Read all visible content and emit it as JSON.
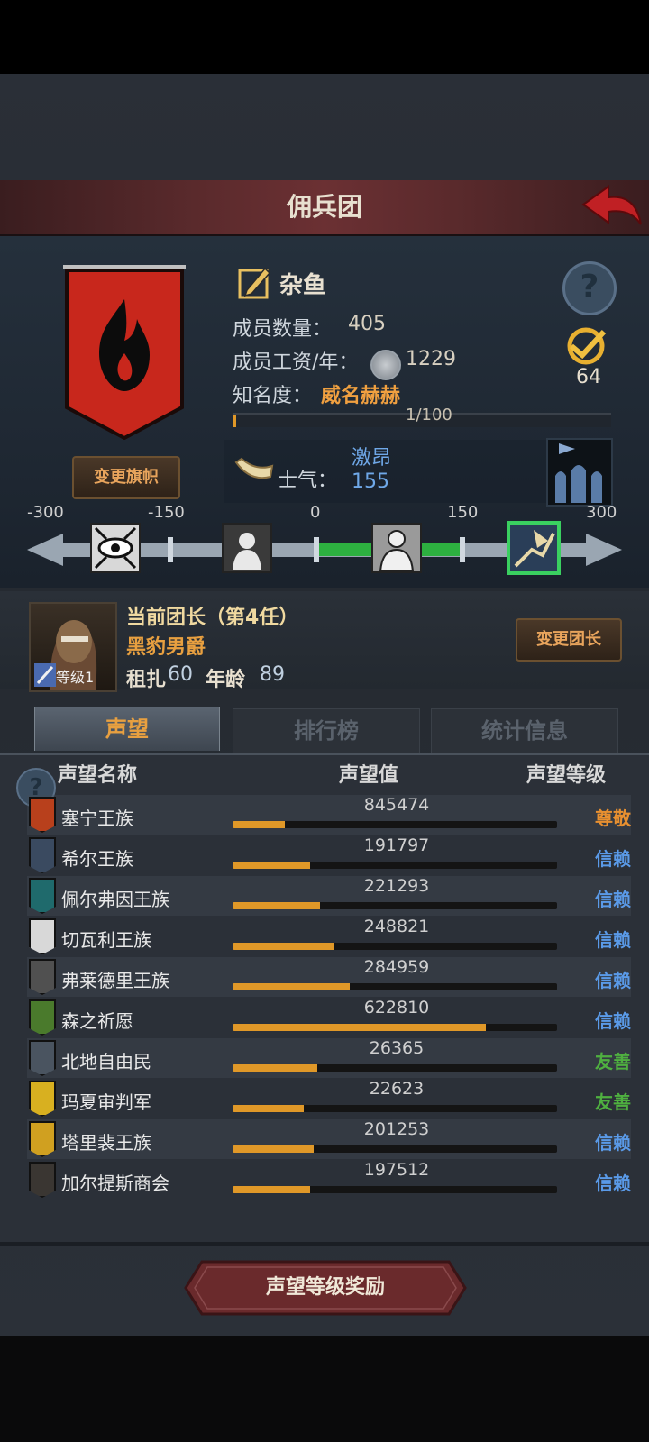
{
  "title": "佣兵团",
  "guild": {
    "name": "杂鱼",
    "members_label": "成员数量：",
    "members_value": "405",
    "salary_label": "成员工资/年：",
    "salary_value": "1229",
    "fame_label": "知名度：",
    "fame_value": "威名赫赫",
    "fame_progress_text": "1/100",
    "fame_progress_fraction": 0.01,
    "badge_count": "64",
    "change_banner_label": "变更旗帜"
  },
  "morale": {
    "label": "士气：",
    "state": "激昂",
    "value": "155",
    "ticks": [
      "-300",
      "-150",
      "0",
      "150",
      "300"
    ]
  },
  "leader": {
    "heading": "当前团长（第4任）",
    "name": "黑豹男爵",
    "race": "租扎",
    "race_num": "60",
    "age_label": "年龄",
    "age": "89",
    "level": "等级1",
    "change_label": "变更团长"
  },
  "tabs": [
    "声望",
    "排行榜",
    "统计信息"
  ],
  "reputation": {
    "headers": [
      "声望名称",
      "声望值",
      "声望等级"
    ],
    "colors": {
      "尊敬": "#e89030",
      "信赖": "#5a9ae8",
      "友善": "#4fb040"
    },
    "rows": [
      {
        "name": "塞宁王族",
        "value": "845474",
        "level": "尊敬",
        "fill": 0.16,
        "icon_color": "#b8401c"
      },
      {
        "name": "希尔王族",
        "value": "191797",
        "level": "信赖",
        "fill": 0.24,
        "icon_color": "#3a4a60"
      },
      {
        "name": "佩尔弗因王族",
        "value": "221293",
        "level": "信赖",
        "fill": 0.27,
        "icon_color": "#1f6a6c"
      },
      {
        "name": "切瓦利王族",
        "value": "248821",
        "level": "信赖",
        "fill": 0.31,
        "icon_color": "#d8d8d8"
      },
      {
        "name": "弗莱德里王族",
        "value": "284959",
        "level": "信赖",
        "fill": 0.36,
        "icon_color": "#505050"
      },
      {
        "name": "森之祈愿",
        "value": "622810",
        "level": "信赖",
        "fill": 0.78,
        "icon_color": "#4a7a2c"
      },
      {
        "name": "北地自由民",
        "value": "26365",
        "level": "友善",
        "fill": 0.26,
        "icon_color": "#4a5460"
      },
      {
        "name": "玛夏审判军",
        "value": "22623",
        "level": "友善",
        "fill": 0.22,
        "icon_color": "#d8b020"
      },
      {
        "name": "塔里裴王族",
        "value": "201253",
        "level": "信赖",
        "fill": 0.25,
        "icon_color": "#d0a020"
      },
      {
        "name": "加尔提斯商会",
        "value": "197512",
        "level": "信赖",
        "fill": 0.24,
        "icon_color": "#3a3632"
      }
    ]
  },
  "reward_button": "声望等级奖励"
}
